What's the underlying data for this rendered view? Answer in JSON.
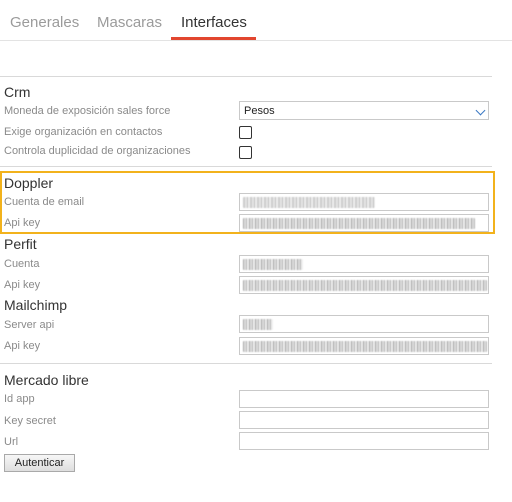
{
  "tabs": [
    {
      "label": "Generales",
      "active": false
    },
    {
      "label": "Mascaras",
      "active": false
    },
    {
      "label": "Interfaces",
      "active": true
    }
  ],
  "accent_color": "#e2462f",
  "highlight_color": "#f2b21c",
  "crm": {
    "title": "Crm",
    "moneda_label": "Moneda de exposición sales force",
    "moneda_value": "Pesos",
    "exige_label": "Exige organización en contactos",
    "exige_checked": false,
    "controla_label": "Controla duplicidad de organizaciones",
    "controla_checked": false
  },
  "doppler": {
    "title": "Doppler",
    "cuenta_label": "Cuenta de email",
    "apikey_label": "Api key"
  },
  "perfit": {
    "title": "Perfit",
    "cuenta_label": "Cuenta",
    "apikey_label": "Api key"
  },
  "mailchimp": {
    "title": "Mailchimp",
    "server_label": "Server api",
    "apikey_label": "Api key"
  },
  "mercadolibre": {
    "title": "Mercado libre",
    "idapp_label": "Id app",
    "keysecret_label": "Key secret",
    "url_label": "Url",
    "authenticate_button": "Autenticar"
  }
}
